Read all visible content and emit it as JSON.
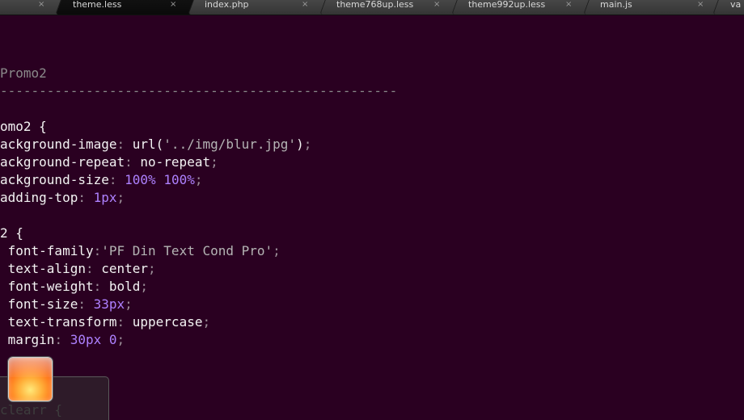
{
  "tabs": [
    {
      "label": "",
      "active": false
    },
    {
      "label": "theme.less",
      "active": true
    },
    {
      "label": "index.php",
      "active": false
    },
    {
      "label": "theme768up.less",
      "active": false
    },
    {
      "label": "theme992up.less",
      "active": false
    },
    {
      "label": "main.js",
      "active": false
    },
    {
      "label": "va",
      "active": false
    }
  ],
  "close_glyph": "×",
  "code_lines": [
    [
      {
        "t": "Promo2",
        "c": "comment"
      }
    ],
    [
      {
        "t": "---------------------------------------------------",
        "c": "comment"
      }
    ],
    [],
    [
      {
        "t": "omo2 {",
        "c": "text"
      }
    ],
    [
      {
        "t": "ackground-image",
        "c": "text"
      },
      {
        "t": ": ",
        "c": "punct"
      },
      {
        "t": "url(",
        "c": "text"
      },
      {
        "t": "'../img/blur.jpg'",
        "c": "string"
      },
      {
        "t": ")",
        "c": "text"
      },
      {
        "t": ";",
        "c": "punct"
      }
    ],
    [
      {
        "t": "ackground-repeat",
        "c": "text"
      },
      {
        "t": ": ",
        "c": "punct"
      },
      {
        "t": "no-repeat",
        "c": "text"
      },
      {
        "t": ";",
        "c": "punct"
      }
    ],
    [
      {
        "t": "ackground-size",
        "c": "text"
      },
      {
        "t": ": ",
        "c": "punct"
      },
      {
        "t": "100",
        "c": "num"
      },
      {
        "t": "%",
        "c": "unit"
      },
      {
        "t": " ",
        "c": "text"
      },
      {
        "t": "100",
        "c": "num"
      },
      {
        "t": "%",
        "c": "unit"
      },
      {
        "t": ";",
        "c": "punct"
      }
    ],
    [
      {
        "t": "adding-top",
        "c": "text"
      },
      {
        "t": ": ",
        "c": "punct"
      },
      {
        "t": "1",
        "c": "num"
      },
      {
        "t": "px",
        "c": "unit"
      },
      {
        "t": ";",
        "c": "punct"
      }
    ],
    [],
    [
      {
        "t": "2 {",
        "c": "text"
      }
    ],
    [
      {
        "t": " font-family",
        "c": "text"
      },
      {
        "t": ":",
        "c": "punct"
      },
      {
        "t": "'PF Din Text Cond Pro'",
        "c": "string"
      },
      {
        "t": ";",
        "c": "punct"
      }
    ],
    [
      {
        "t": " text-align",
        "c": "text"
      },
      {
        "t": ": ",
        "c": "punct"
      },
      {
        "t": "center",
        "c": "text"
      },
      {
        "t": ";",
        "c": "punct"
      }
    ],
    [
      {
        "t": " font-weight",
        "c": "text"
      },
      {
        "t": ": ",
        "c": "punct"
      },
      {
        "t": "bold",
        "c": "text"
      },
      {
        "t": ";",
        "c": "punct"
      }
    ],
    [
      {
        "t": " font-size",
        "c": "text"
      },
      {
        "t": ": ",
        "c": "punct"
      },
      {
        "t": "33",
        "c": "num"
      },
      {
        "t": "px",
        "c": "unit"
      },
      {
        "t": ";",
        "c": "punct"
      }
    ],
    [
      {
        "t": " text-transform",
        "c": "text"
      },
      {
        "t": ": ",
        "c": "punct"
      },
      {
        "t": "uppercase",
        "c": "text"
      },
      {
        "t": ";",
        "c": "punct"
      }
    ],
    [
      {
        "t": " margin",
        "c": "text"
      },
      {
        "t": ": ",
        "c": "punct"
      },
      {
        "t": "30",
        "c": "num"
      },
      {
        "t": "px",
        "c": "unit"
      },
      {
        "t": " ",
        "c": "text"
      },
      {
        "t": "0",
        "c": "num"
      },
      {
        "t": ";",
        "c": "punct"
      }
    ]
  ],
  "ghost_text": "clearr {",
  "colors": {
    "editor_bg": "#2a0021",
    "text": "#f3f3f3",
    "comment": "#8a8a8a",
    "number": "#ae81ff",
    "string": "#b4b4b4"
  },
  "icons": {
    "tab_close": "close-icon",
    "taskbar_app": "photo-app-icon"
  }
}
